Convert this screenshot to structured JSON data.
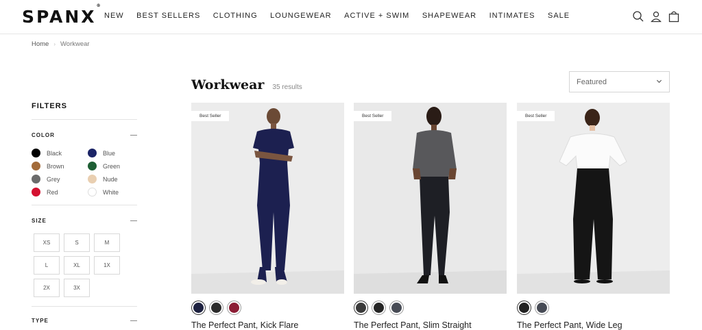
{
  "brand": {
    "name": "SPANX",
    "trademark": "®"
  },
  "nav": [
    {
      "label": "NEW"
    },
    {
      "label": "BEST SELLERS"
    },
    {
      "label": "CLOTHING"
    },
    {
      "label": "LOUNGEWEAR"
    },
    {
      "label": "ACTIVE + SWIM"
    },
    {
      "label": "SHAPEWEAR"
    },
    {
      "label": "INTIMATES"
    },
    {
      "label": "SALE"
    }
  ],
  "header_icons": [
    "search-icon",
    "account-icon",
    "bag-icon"
  ],
  "breadcrumb": {
    "home": "Home",
    "separator": "›",
    "current": "Workwear"
  },
  "page": {
    "title": "Workwear",
    "result_count": "35 results"
  },
  "sort": {
    "selected": "Featured"
  },
  "filters": {
    "title": "FILTERS",
    "color": {
      "heading": "COLOR",
      "options": [
        {
          "label": "Black",
          "hex": "#000000"
        },
        {
          "label": "Blue",
          "hex": "#1b2466"
        },
        {
          "label": "Brown",
          "hex": "#a36b3a"
        },
        {
          "label": "Green",
          "hex": "#1e5e34"
        },
        {
          "label": "Grey",
          "hex": "#6b6b6b"
        },
        {
          "label": "Nude",
          "hex": "#e9cfb1"
        },
        {
          "label": "Red",
          "hex": "#d41130"
        },
        {
          "label": "White",
          "hex": "#ffffff"
        }
      ]
    },
    "size": {
      "heading": "SIZE",
      "options": [
        "XS",
        "S",
        "M",
        "L",
        "XL",
        "1X",
        "2X",
        "3X"
      ]
    },
    "type": {
      "heading": "TYPE"
    }
  },
  "products": [
    {
      "badge": "Best Seller",
      "name": "The Perfect Pant, Kick Flare",
      "colors": [
        "#1d2140",
        "#2b2b2b",
        "#8c1d35"
      ],
      "icon": "model-kick-flare"
    },
    {
      "badge": "Best Seller",
      "name": "The Perfect Pant, Slim Straight",
      "colors": [
        "#3a3a3a",
        "#252525",
        "#474b55"
      ],
      "icon": "model-slim-straight"
    },
    {
      "badge": "Best Seller",
      "name": "The Perfect Pant, Wide Leg",
      "colors": [
        "#222222",
        "#474b55"
      ],
      "icon": "model-wide-leg"
    }
  ]
}
